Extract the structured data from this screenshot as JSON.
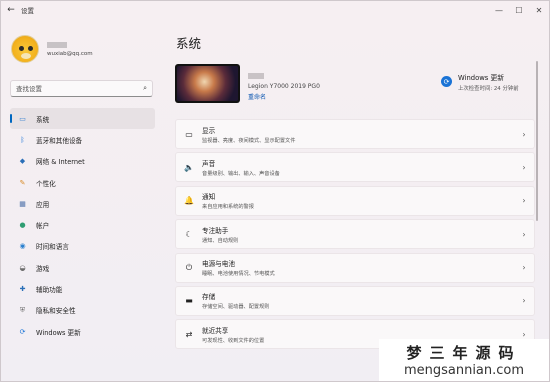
{
  "window": {
    "title": "设置",
    "back_glyph": "←",
    "controls": {
      "minimize": "—",
      "maximize": "☐",
      "close": "✕"
    }
  },
  "profile": {
    "email": "wuxiab@qq.com"
  },
  "search": {
    "placeholder": "查找设置",
    "icon": "search-icon"
  },
  "nav": [
    {
      "label": "系统",
      "icon": "monitor-icon",
      "glyph": "▭",
      "color": "#2e7dd1",
      "active": true
    },
    {
      "label": "蓝牙和其他设备",
      "icon": "bluetooth-icon",
      "glyph": "ᛒ",
      "color": "#1a73d6",
      "active": false
    },
    {
      "label": "网络 & Internet",
      "icon": "wifi-icon",
      "glyph": "◆",
      "color": "#2a6fb8",
      "active": false
    },
    {
      "label": "个性化",
      "icon": "brush-icon",
      "glyph": "✎",
      "color": "#d98c2a",
      "active": false
    },
    {
      "label": "应用",
      "icon": "apps-icon",
      "glyph": "▦",
      "color": "#4b6ea8",
      "active": false
    },
    {
      "label": "帐户",
      "icon": "person-icon",
      "glyph": "●",
      "color": "#2f9d72",
      "active": false
    },
    {
      "label": "时间和语言",
      "icon": "globe-icon",
      "glyph": "◉",
      "color": "#2b80cf",
      "active": false
    },
    {
      "label": "游戏",
      "icon": "gamepad-icon",
      "glyph": "◒",
      "color": "#6c6c6c",
      "active": false
    },
    {
      "label": "辅助功能",
      "icon": "accessibility-icon",
      "glyph": "✚",
      "color": "#2a6fb8",
      "active": false
    },
    {
      "label": "隐私和安全性",
      "icon": "shield-icon",
      "glyph": "⛨",
      "color": "#6f6f6f",
      "active": false
    },
    {
      "label": "Windows 更新",
      "icon": "update-icon",
      "glyph": "⟳",
      "color": "#1a73d6",
      "active": false
    }
  ],
  "main": {
    "title": "系统",
    "device": {
      "model": "Legion Y7000 2019 PG0",
      "rename_label": "重命名"
    },
    "windows_update": {
      "title": "Windows 更新",
      "subtitle": "上次检查时间: 24 分钟前"
    },
    "cards": [
      {
        "title": "显示",
        "desc": "监视器、亮度、夜间模式、显示配置文件",
        "icon": "display-icon",
        "glyph": "▭"
      },
      {
        "title": "声音",
        "desc": "音量级别、输出、输入、声音设备",
        "icon": "speaker-icon",
        "glyph": "🔈"
      },
      {
        "title": "通知",
        "desc": "来自应用和系统的警报",
        "icon": "bell-icon",
        "glyph": "🔔"
      },
      {
        "title": "专注助手",
        "desc": "通知、自动规则",
        "icon": "moon-icon",
        "glyph": "☾"
      },
      {
        "title": "电源与电池",
        "desc": "睡眠、电池使用情况、节电模式",
        "icon": "power-icon",
        "glyph": "⏻"
      },
      {
        "title": "存储",
        "desc": "存储空间、驱动器、配置规则",
        "icon": "storage-icon",
        "glyph": "▬"
      },
      {
        "title": "就近共享",
        "desc": "可发现性、收到文件的位置",
        "icon": "share-icon",
        "glyph": "⇄"
      }
    ],
    "chevron": "›"
  },
  "watermark": {
    "cn": "梦三年源码",
    "en": "mengsannian.com"
  }
}
